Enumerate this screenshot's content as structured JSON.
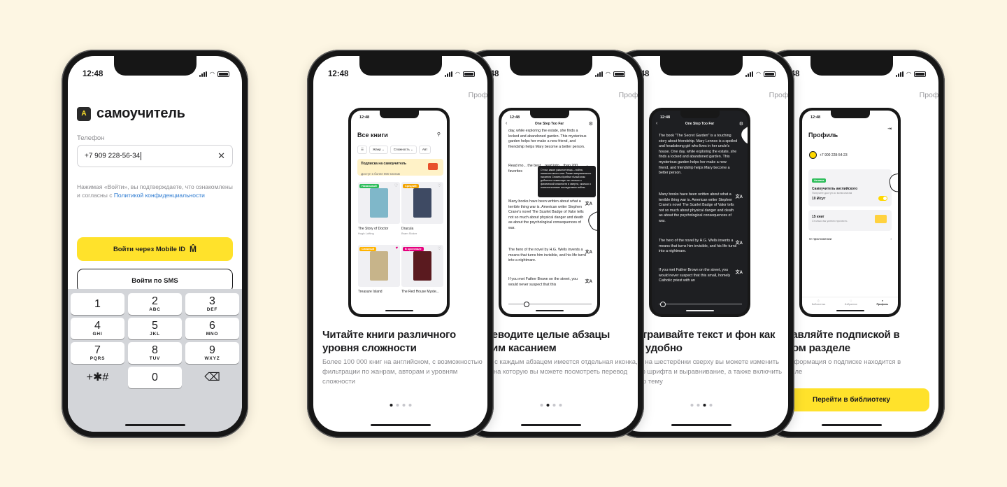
{
  "status": {
    "time": "12:48"
  },
  "login": {
    "brand": "самоучитель",
    "logo_text": "А",
    "phone_label": "Телефон",
    "phone_value": "+7 909 228-56-34",
    "clear_icon": "✕",
    "consent_text": "Нажимая «Войти», вы подтверждаете, что ознакомлены и согласны с ",
    "consent_link": "Политикой конфиденциальности",
    "mobile_id_button": "Войти через Mobile ID",
    "mobile_id_mark": "M̂",
    "sms_button": "Войти по SMS",
    "keypad": [
      {
        "d": "1",
        "l": ""
      },
      {
        "d": "2",
        "l": "ABC"
      },
      {
        "d": "3",
        "l": "DEF"
      },
      {
        "d": "4",
        "l": "GHI"
      },
      {
        "d": "5",
        "l": "JKL"
      },
      {
        "d": "6",
        "l": "MNO"
      },
      {
        "d": "7",
        "l": "PQRS"
      },
      {
        "d": "8",
        "l": "TUV"
      },
      {
        "d": "9",
        "l": "WXYZ"
      },
      {
        "d": "+✱#",
        "l": ""
      },
      {
        "d": "0",
        "l": ""
      },
      {
        "d": "⌫",
        "l": ""
      }
    ]
  },
  "profile_link": "Профиль",
  "onboarding": [
    {
      "title": "Читайте книги различного уровня сложности",
      "text": "Более 100 000 книг на английском, с возможностью фильтрации по жанрам, авторам и уровням сложности",
      "active": 0
    },
    {
      "title": "Переводите целые абзацы одним касанием",
      "text": "Рядом с каждым абзацем имеется отдельная иконка, нажав на которую вы можете посмотреть перевод",
      "active": 1
    },
    {
      "title": "Настраивайте текст и фон как вам удобно",
      "text": "Нажав на шестерёнки сверху вы можете изменить размер шрифта и выравнивание, а также включить тёмную тему",
      "active": 2
    },
    {
      "title": "Управляйте подпиской в одном разделе",
      "text": "Вся информация о подписке находится в Профиле",
      "active": 3
    }
  ],
  "library_button": "Перейти в библиотеку",
  "mini_library": {
    "title": "Все книги",
    "chips": [
      "Жанр ⌄",
      "Сложность ⌄",
      "Авт"
    ],
    "promo_title": "Подписка на самоучитель",
    "promo_sub": "Доступ к более 800 книгам",
    "books": [
      {
        "title": "The Story of Doctor",
        "author": "Hugh Lofting",
        "tag": "Начальный",
        "tag_color": "#2dbd5a",
        "cover": "#7fb7c9"
      },
      {
        "title": "Dracula",
        "author": "Bram Stoker",
        "tag": "Средний",
        "tag_color": "#f2a400",
        "cover": "#3e4a63"
      },
      {
        "title": "Treasure Island",
        "author": "",
        "tag": "Сложный",
        "tag_color": "#ffb300",
        "cover": "#c7b48a"
      },
      {
        "title": "The Red House Myste...",
        "author": "",
        "tag": "В оригинале",
        "tag_color": "#e6007e",
        "cover": "#5a1a1f"
      }
    ]
  },
  "mini_reader": {
    "title": "One Step Too Far",
    "paras_light": [
      "day, while exploring the estate, she finds a locked and abandoned garden. This mysterious garden helps her make a new friend, and friendship helps Mary become a better person.",
      "Read mo... the best... read into... than 200... favorites",
      "Many books have been written about what a terrible thing war is. American writer Stephen Crane's novel The Scarlet Badge of Valor tells not so much about physical danger and death as about the psychological consequences of war.",
      "The hero of the novel by H.G. Wells invents a means that turns him invisible, and his life turns into a nightmare.",
      "If you met Father Brown on the street, you would never suspect that this"
    ],
    "popup": "О том, какое ужасное вещь – война, написано много книг. Роман американского писателя Стивена Крейна «Алый знак доблести» повествует не столько о физической опасности и смерти, сколько о психологических последствиях войны.",
    "paras_dark": [
      "The book \"The Secret Garden\" is a touching story about friendship. Mary Lennox is a spoiled and headstrong girl who lives in her uncle's house. One day, while exploring the estate, she finds a locked and abandoned garden. This mysterious garden helps her make a new friend, and friendship helps Mary become a better person.",
      "Many books have been written about what a terrible thing war is. American writer Stephen Crane's novel The Scarlet Badge of Valor tells not so much about physical danger and death as about the psychological consequences of war.",
      "The hero of the novel by H.G. Wells invents a means that turns him invisible, and his life turns into a nightmare.",
      "If you met Father Brown on the street, you would never suspect that this small, homely Catholic priest with an"
    ]
  },
  "mini_profile": {
    "title": "Профиль",
    "phone": "+7 900 228-54-23",
    "pill": "Активна",
    "sub_title": "Самоучитель английского",
    "sub_text": "Получите доступ ко всем книгам",
    "price": "10 ₽/сут",
    "books_title": "15 книг",
    "books_text": "Столько вы успели прочесть",
    "about": "О приложении",
    "tabs": [
      "Библиотека",
      "Избранное",
      "Профиль"
    ]
  },
  "colors": {
    "accent": "#ffe22b",
    "background": "#fdf6e3",
    "link": "#2d7bd1"
  }
}
